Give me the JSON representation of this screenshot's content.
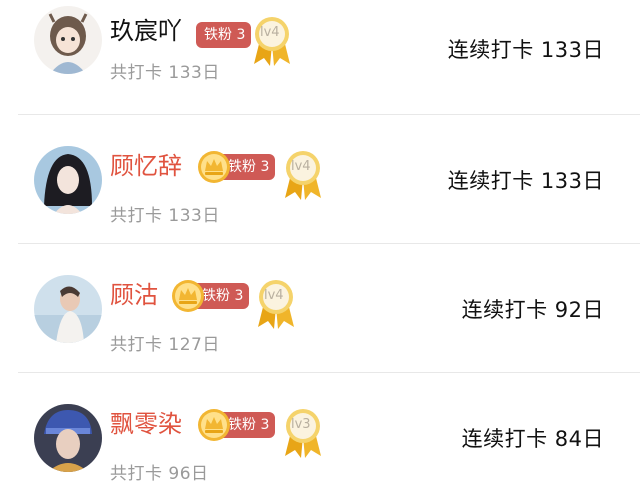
{
  "rows": [
    {
      "name": "玖宸吖",
      "name_color": "#111111",
      "fan_badge": "铁粉 3",
      "crowned": false,
      "level": "lv4",
      "total": "共打卡 133日",
      "streak": "连续打卡 133日"
    },
    {
      "name": "顾忆辞",
      "name_color": "#e0533f",
      "fan_badge": "铁粉 3",
      "crowned": true,
      "level": "lv4",
      "total": "共打卡 133日",
      "streak": "连续打卡 133日"
    },
    {
      "name": "顾沽",
      "name_color": "#e0533f",
      "fan_badge": "铁粉 3",
      "crowned": true,
      "level": "lv4",
      "total": "共打卡 127日",
      "streak": "连续打卡 92日"
    },
    {
      "name": "飘零染",
      "name_color": "#e0533f",
      "fan_badge": "铁粉 3",
      "crowned": true,
      "level": "lv3",
      "total": "共打卡 96日",
      "streak": "连续打卡 84日"
    }
  ],
  "icons": {
    "crown": "crown-icon",
    "medal": "level-medal-icon"
  },
  "colors": {
    "badge_bg": "#cf5a55",
    "crown_gold": "#f2b632",
    "medal_ribbon": "#e8a516"
  }
}
